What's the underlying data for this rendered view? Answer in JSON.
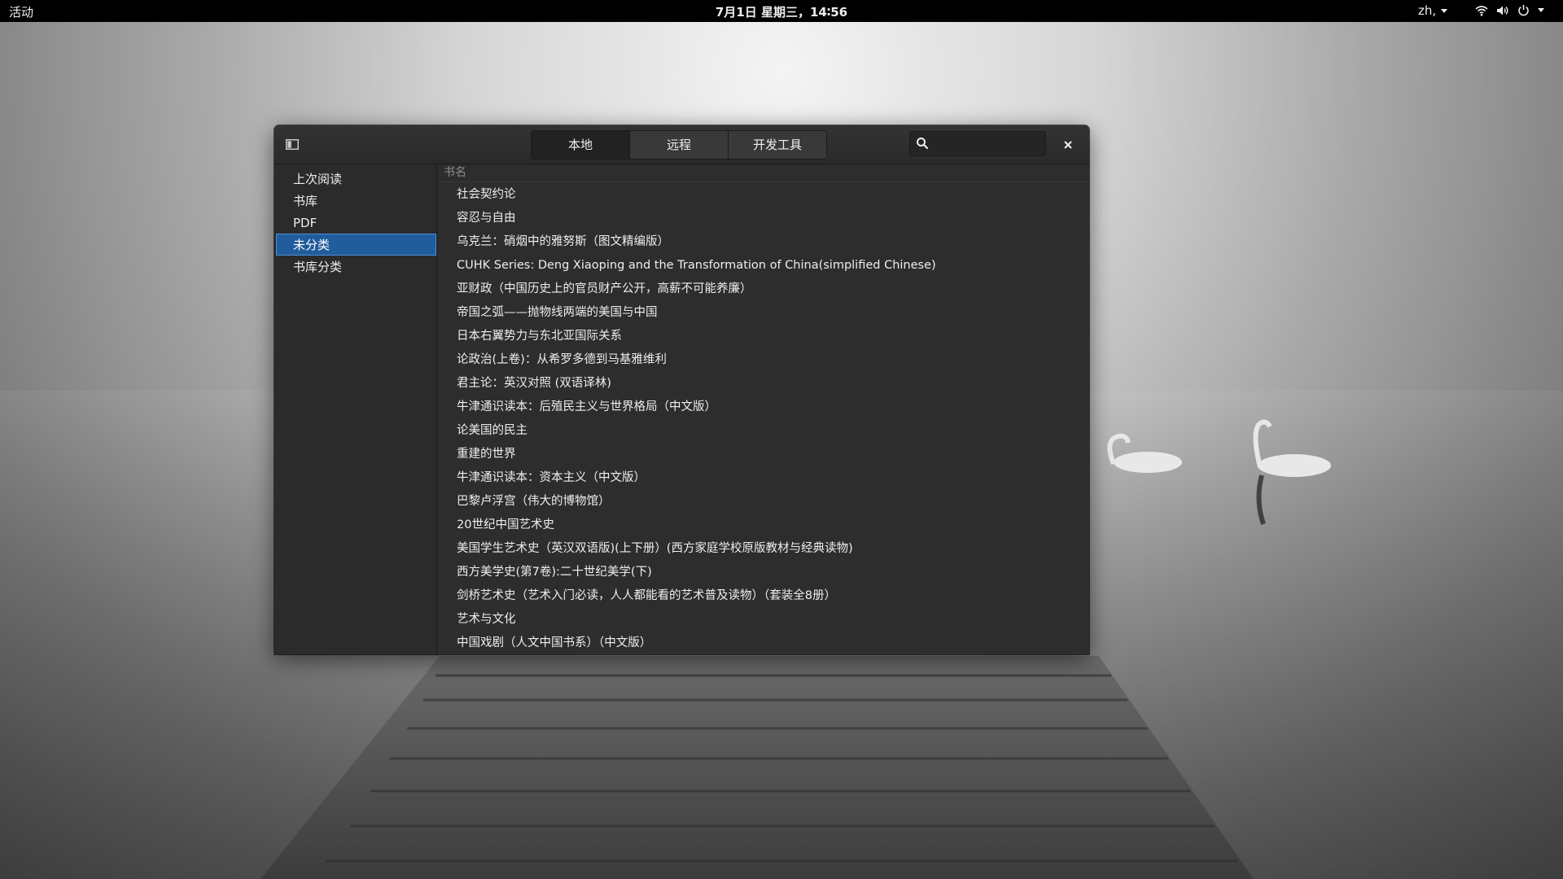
{
  "topbar": {
    "activities": "活动",
    "clock": "7月1日 星期三，14∶56",
    "language": "zh",
    "language_suffix": ","
  },
  "window": {
    "tabs": [
      {
        "label": "本地",
        "active": true
      },
      {
        "label": "远程",
        "active": false
      },
      {
        "label": "开发工具",
        "active": false
      }
    ],
    "search": {
      "value": "",
      "placeholder": ""
    }
  },
  "sidebar": {
    "items": [
      {
        "label": "上次阅读",
        "selected": false
      },
      {
        "label": "书库",
        "selected": false
      },
      {
        "label": "PDF",
        "selected": false
      },
      {
        "label": "未分类",
        "selected": true
      },
      {
        "label": "书库分类",
        "selected": false
      }
    ]
  },
  "books": {
    "column_header": "书名",
    "rows": [
      "社会契约论",
      "容忍与自由",
      "乌克兰：硝烟中的雅努斯（图文精编版）",
      "CUHK Series: Deng Xiaoping and the Transformation of China(simplified Chinese)",
      "亚财政（中国历史上的官员财产公开，高薪不可能养廉）",
      "帝国之弧——抛物线两端的美国与中国",
      "日本右翼势力与东北亚国际关系",
      "论政治(上卷)：从希罗多德到马基雅维利",
      "君主论：英汉对照 (双语译林)",
      "牛津通识读本：后殖民主义与世界格局（中文版）",
      "论美国的民主",
      "重建的世界",
      "牛津通识读本：资本主义（中文版）",
      "巴黎卢浮宫（伟大的博物馆）",
      "20世纪中国艺术史",
      "美国学生艺术史（英汉双语版)(上下册）(西方家庭学校原版教材与经典读物)",
      "西方美学史(第7卷):二十世纪美学(下)",
      "剑桥艺术史（艺术入门必读，人人都能看的艺术普及读物）（套装全8册）",
      "艺术与文化",
      "中国戏剧（人文中国书系）（中文版）"
    ]
  },
  "colors": {
    "accent": "#215d9c",
    "window_bg": "#2b2b2b",
    "topbar_bg": "#000000"
  },
  "icons": {
    "sidebar_toggle": "sidebar-toggle-icon",
    "search": "search-icon",
    "close": "close-icon",
    "network": "wifi-icon",
    "volume": "volume-icon",
    "power": "power-icon"
  }
}
